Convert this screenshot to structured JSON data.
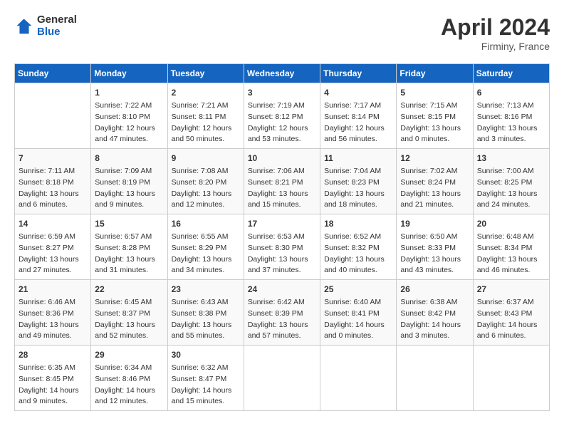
{
  "header": {
    "logo": {
      "general": "General",
      "blue": "Blue"
    },
    "month_year": "April 2024",
    "location": "Firminy, France"
  },
  "weekdays": [
    "Sunday",
    "Monday",
    "Tuesday",
    "Wednesday",
    "Thursday",
    "Friday",
    "Saturday"
  ],
  "weeks": [
    [
      {
        "day": "",
        "info": ""
      },
      {
        "day": "1",
        "info": "Sunrise: 7:22 AM\nSunset: 8:10 PM\nDaylight: 12 hours\nand 47 minutes."
      },
      {
        "day": "2",
        "info": "Sunrise: 7:21 AM\nSunset: 8:11 PM\nDaylight: 12 hours\nand 50 minutes."
      },
      {
        "day": "3",
        "info": "Sunrise: 7:19 AM\nSunset: 8:12 PM\nDaylight: 12 hours\nand 53 minutes."
      },
      {
        "day": "4",
        "info": "Sunrise: 7:17 AM\nSunset: 8:14 PM\nDaylight: 12 hours\nand 56 minutes."
      },
      {
        "day": "5",
        "info": "Sunrise: 7:15 AM\nSunset: 8:15 PM\nDaylight: 13 hours\nand 0 minutes."
      },
      {
        "day": "6",
        "info": "Sunrise: 7:13 AM\nSunset: 8:16 PM\nDaylight: 13 hours\nand 3 minutes."
      }
    ],
    [
      {
        "day": "7",
        "info": "Sunrise: 7:11 AM\nSunset: 8:18 PM\nDaylight: 13 hours\nand 6 minutes."
      },
      {
        "day": "8",
        "info": "Sunrise: 7:09 AM\nSunset: 8:19 PM\nDaylight: 13 hours\nand 9 minutes."
      },
      {
        "day": "9",
        "info": "Sunrise: 7:08 AM\nSunset: 8:20 PM\nDaylight: 13 hours\nand 12 minutes."
      },
      {
        "day": "10",
        "info": "Sunrise: 7:06 AM\nSunset: 8:21 PM\nDaylight: 13 hours\nand 15 minutes."
      },
      {
        "day": "11",
        "info": "Sunrise: 7:04 AM\nSunset: 8:23 PM\nDaylight: 13 hours\nand 18 minutes."
      },
      {
        "day": "12",
        "info": "Sunrise: 7:02 AM\nSunset: 8:24 PM\nDaylight: 13 hours\nand 21 minutes."
      },
      {
        "day": "13",
        "info": "Sunrise: 7:00 AM\nSunset: 8:25 PM\nDaylight: 13 hours\nand 24 minutes."
      }
    ],
    [
      {
        "day": "14",
        "info": "Sunrise: 6:59 AM\nSunset: 8:27 PM\nDaylight: 13 hours\nand 27 minutes."
      },
      {
        "day": "15",
        "info": "Sunrise: 6:57 AM\nSunset: 8:28 PM\nDaylight: 13 hours\nand 31 minutes."
      },
      {
        "day": "16",
        "info": "Sunrise: 6:55 AM\nSunset: 8:29 PM\nDaylight: 13 hours\nand 34 minutes."
      },
      {
        "day": "17",
        "info": "Sunrise: 6:53 AM\nSunset: 8:30 PM\nDaylight: 13 hours\nand 37 minutes."
      },
      {
        "day": "18",
        "info": "Sunrise: 6:52 AM\nSunset: 8:32 PM\nDaylight: 13 hours\nand 40 minutes."
      },
      {
        "day": "19",
        "info": "Sunrise: 6:50 AM\nSunset: 8:33 PM\nDaylight: 13 hours\nand 43 minutes."
      },
      {
        "day": "20",
        "info": "Sunrise: 6:48 AM\nSunset: 8:34 PM\nDaylight: 13 hours\nand 46 minutes."
      }
    ],
    [
      {
        "day": "21",
        "info": "Sunrise: 6:46 AM\nSunset: 8:36 PM\nDaylight: 13 hours\nand 49 minutes."
      },
      {
        "day": "22",
        "info": "Sunrise: 6:45 AM\nSunset: 8:37 PM\nDaylight: 13 hours\nand 52 minutes."
      },
      {
        "day": "23",
        "info": "Sunrise: 6:43 AM\nSunset: 8:38 PM\nDaylight: 13 hours\nand 55 minutes."
      },
      {
        "day": "24",
        "info": "Sunrise: 6:42 AM\nSunset: 8:39 PM\nDaylight: 13 hours\nand 57 minutes."
      },
      {
        "day": "25",
        "info": "Sunrise: 6:40 AM\nSunset: 8:41 PM\nDaylight: 14 hours\nand 0 minutes."
      },
      {
        "day": "26",
        "info": "Sunrise: 6:38 AM\nSunset: 8:42 PM\nDaylight: 14 hours\nand 3 minutes."
      },
      {
        "day": "27",
        "info": "Sunrise: 6:37 AM\nSunset: 8:43 PM\nDaylight: 14 hours\nand 6 minutes."
      }
    ],
    [
      {
        "day": "28",
        "info": "Sunrise: 6:35 AM\nSunset: 8:45 PM\nDaylight: 14 hours\nand 9 minutes."
      },
      {
        "day": "29",
        "info": "Sunrise: 6:34 AM\nSunset: 8:46 PM\nDaylight: 14 hours\nand 12 minutes."
      },
      {
        "day": "30",
        "info": "Sunrise: 6:32 AM\nSunset: 8:47 PM\nDaylight: 14 hours\nand 15 minutes."
      },
      {
        "day": "",
        "info": ""
      },
      {
        "day": "",
        "info": ""
      },
      {
        "day": "",
        "info": ""
      },
      {
        "day": "",
        "info": ""
      }
    ]
  ]
}
